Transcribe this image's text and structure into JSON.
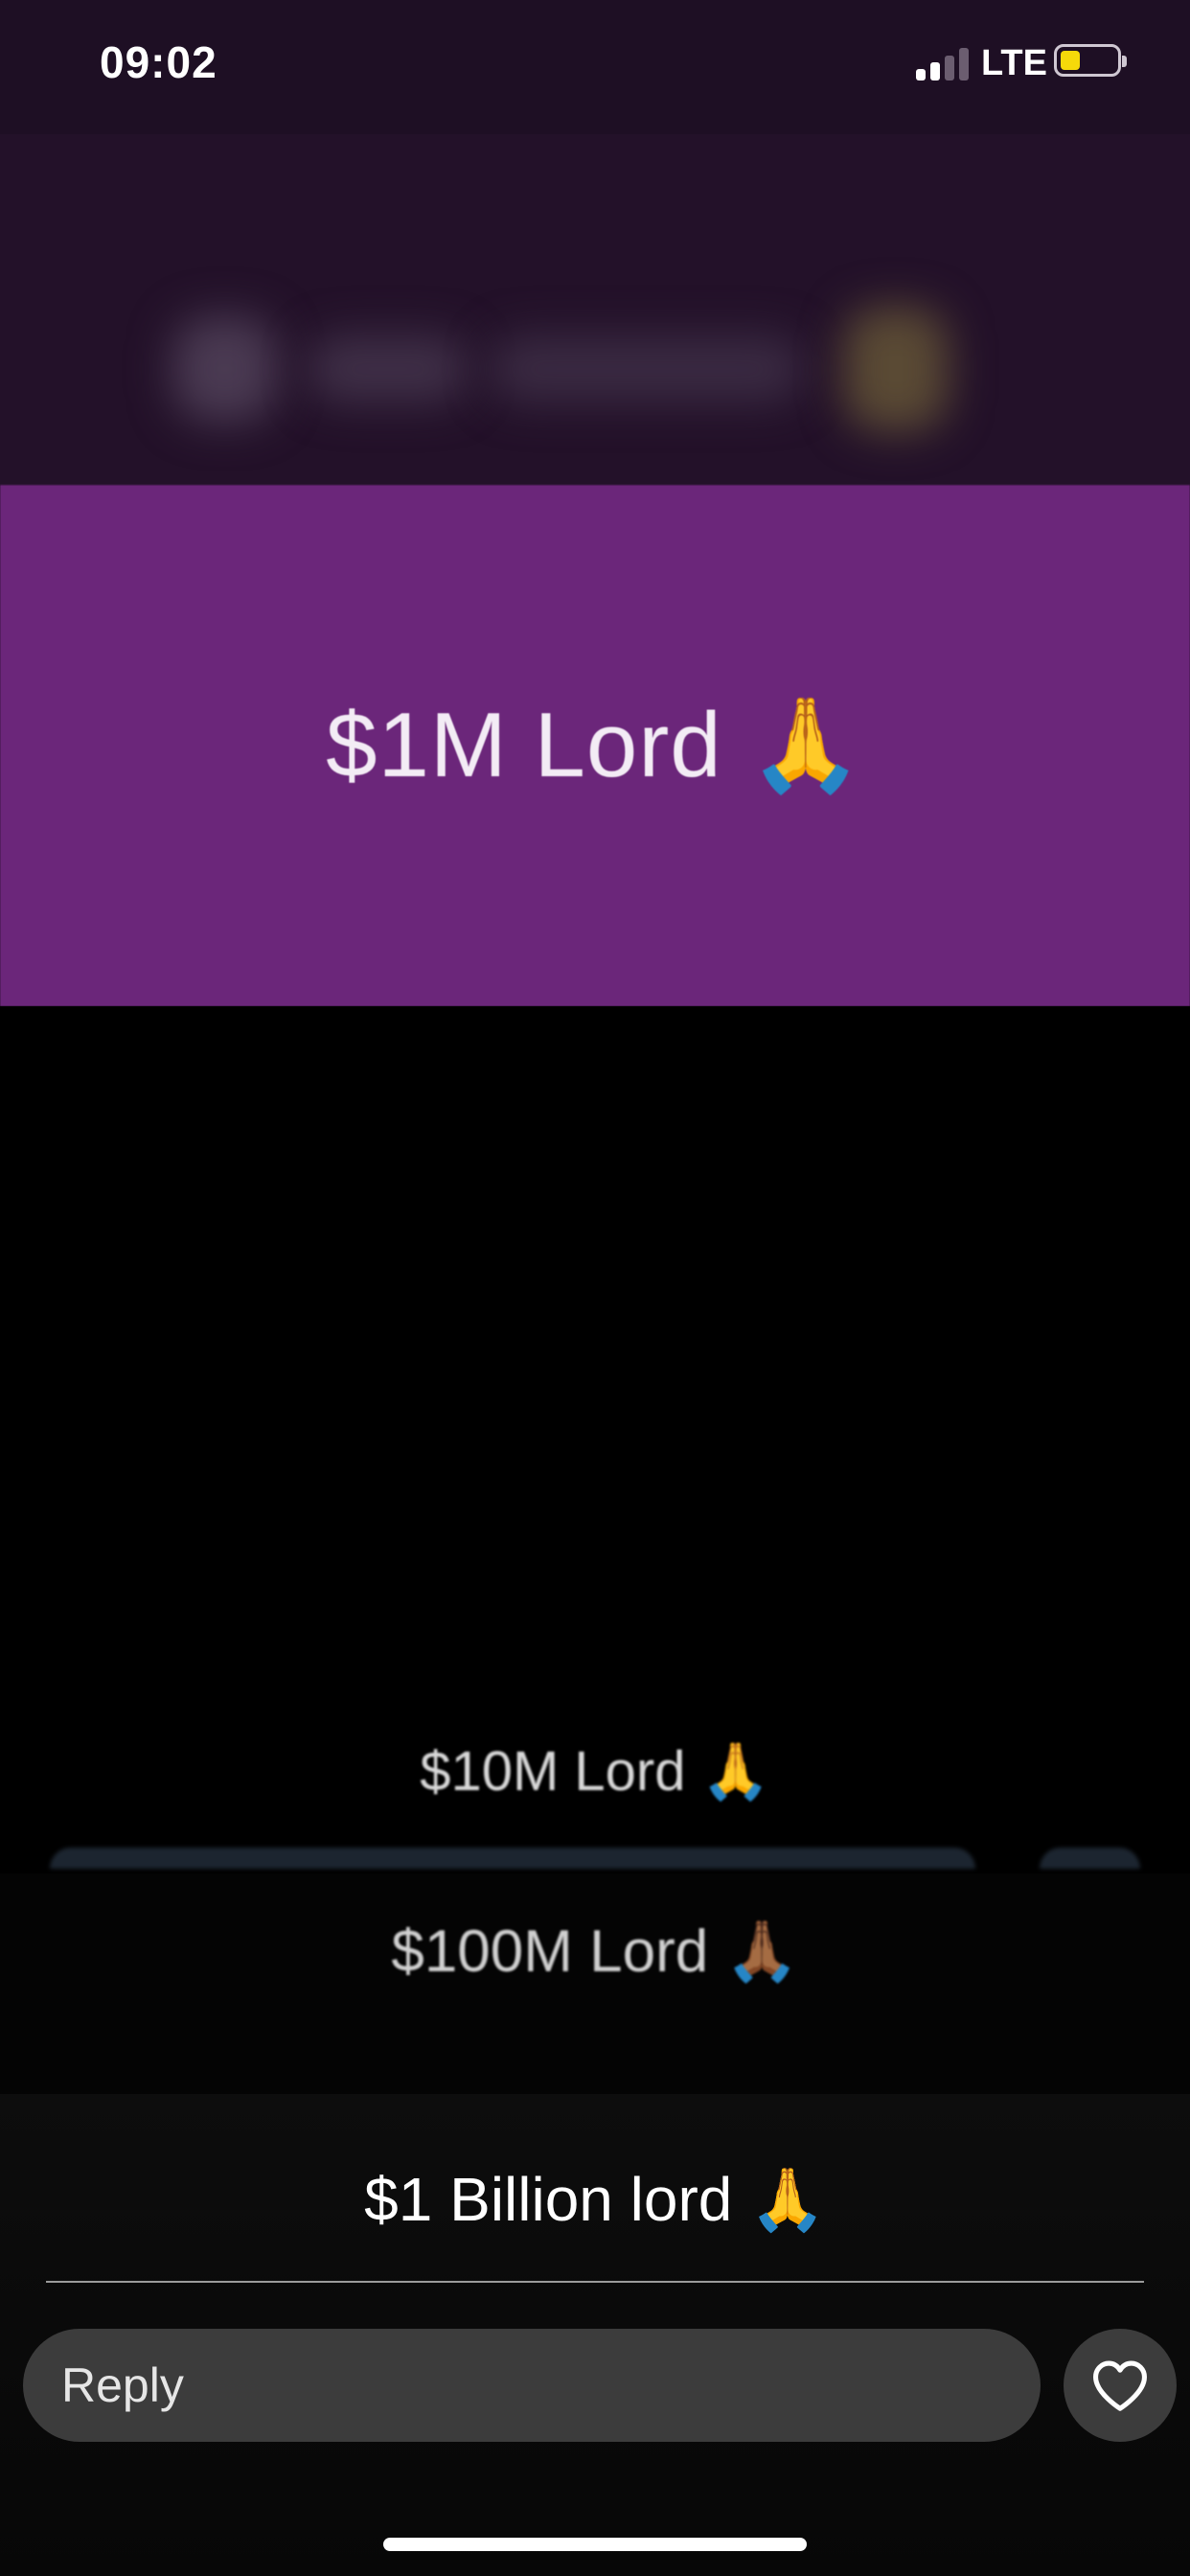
{
  "status_bar": {
    "time": "09:02",
    "network": "LTE",
    "battery_level": 0.3
  },
  "story": {
    "banner_text": "$1M Lord 🙏",
    "options": [
      {
        "label": "$10M Lord 🙏"
      },
      {
        "label": "$100M Lord 🙏🏾"
      }
    ],
    "caption": "$1 Billion lord 🙏"
  },
  "reply_bar": {
    "placeholder": "Reply",
    "like_icon": "heart-icon"
  },
  "colors": {
    "banner": "#6b267a",
    "header": "#231129",
    "battery": "#f5d90a"
  }
}
